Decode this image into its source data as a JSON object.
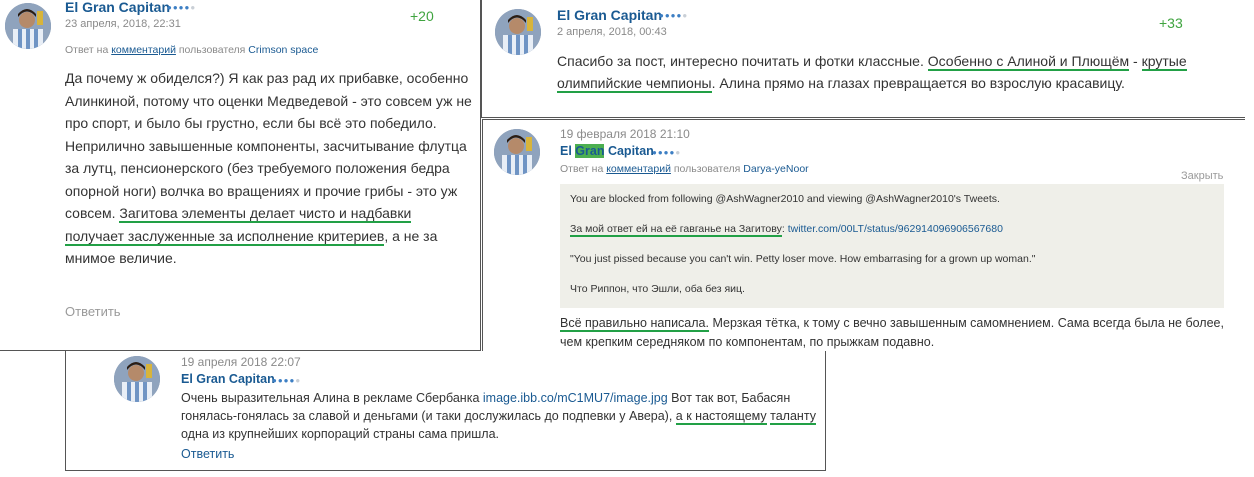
{
  "comment1": {
    "user": "El Gran Capitan",
    "rank_dots": {
      "filled": 4,
      "total": 5
    },
    "date": "23 апреля, 2018, 22:31",
    "score": "+20",
    "reply_prefix": "Ответ на",
    "reply_link": "комментарий",
    "reply_mid": "пользователя",
    "reply_user": "Crimson space",
    "text_before": "Да почему ж обиделся?) Я как раз рад их прибавке, особенно Алинкиной, потому что оценки Медведевой - это совсем уж не про спорт, и было бы грустно, если бы всё это победило. Неприлично завышенные компоненты, засчитывание флутца за лутц, пенсионерского (без требуемого положения бедра опорной ноги) волчка во вращениях и прочие грибы - это уж совсем. ",
    "text_highlight": "Загитова элементы делает чисто и надбавки получает заслуженные за исполнение критериев",
    "text_after": ", а не за мнимое величие.",
    "action": "Ответить"
  },
  "comment2": {
    "user": "El Gran Capitan",
    "rank_dots": {
      "filled": 4,
      "total": 5
    },
    "date": "2 апреля, 2018, 00:43",
    "score": "+33",
    "text_before": "Спасибо за пост, интересно почитать и фотки классные. ",
    "text_hl1": "Особенно с Алиной и Плющём",
    "text_mid": " - ",
    "text_hl2": "крутые олимпийские чемпионы",
    "text_after": ". Алина прямо на глазах превращается во взрослую красавицу."
  },
  "comment3": {
    "user_before": "El ",
    "user_highlight": "Gran",
    "user_after": " Capitan",
    "rank_dots": {
      "filled": 4,
      "total": 5
    },
    "date": "19 февраля 2018 21:10",
    "reply_prefix": "Ответ на",
    "reply_link": "комментарий",
    "reply_mid": "пользователя",
    "reply_user": "Darya-yeNoor",
    "close_label": "Закрыть",
    "quote_line1": "You are blocked from following @AshWagner2010 and viewing @AshWagner2010's Tweets.",
    "quote_line2_hl": "За мой ответ ей на её гавганье на Загитову",
    "quote_line2_sep": ": ",
    "quote_line2_link": "twitter.com/00LT/status/962914096906567680",
    "quote_line3": "\"You just pissed because you can't win. Petty loser move. How embarrasing for a grown up woman.\"",
    "quote_line4": "Что Риппон, что Эшли, оба без яиц.",
    "text_hl": "Всё правильно написала.",
    "text_after": " Мерзкая тётка, к тому с вечно завышенным самомнением. Сама всегда была не более, чем крепким середняком по компонентам, по прыжкам подавно."
  },
  "comment4": {
    "user": "El Gran Capitan",
    "rank_dots": {
      "filled": 4,
      "total": 5
    },
    "date": "19 апреля 2018 22:07",
    "text_before": "Очень выразительная Алина в рекламе Сбербанка ",
    "text_link": "image.ibb.co/mC1MU7/image.jpg",
    "text_mid": " Вот так вот, Бабасян гонялась-гонялась за славой и деньгами (и таки дослужилась до подпевки у Авера), ",
    "text_hl1": "а к настоящему",
    "text_space": " ",
    "text_hl2": "таланту",
    "text_after": " одна из крупнейших корпораций страны сама пришла.",
    "action": "Ответить"
  }
}
